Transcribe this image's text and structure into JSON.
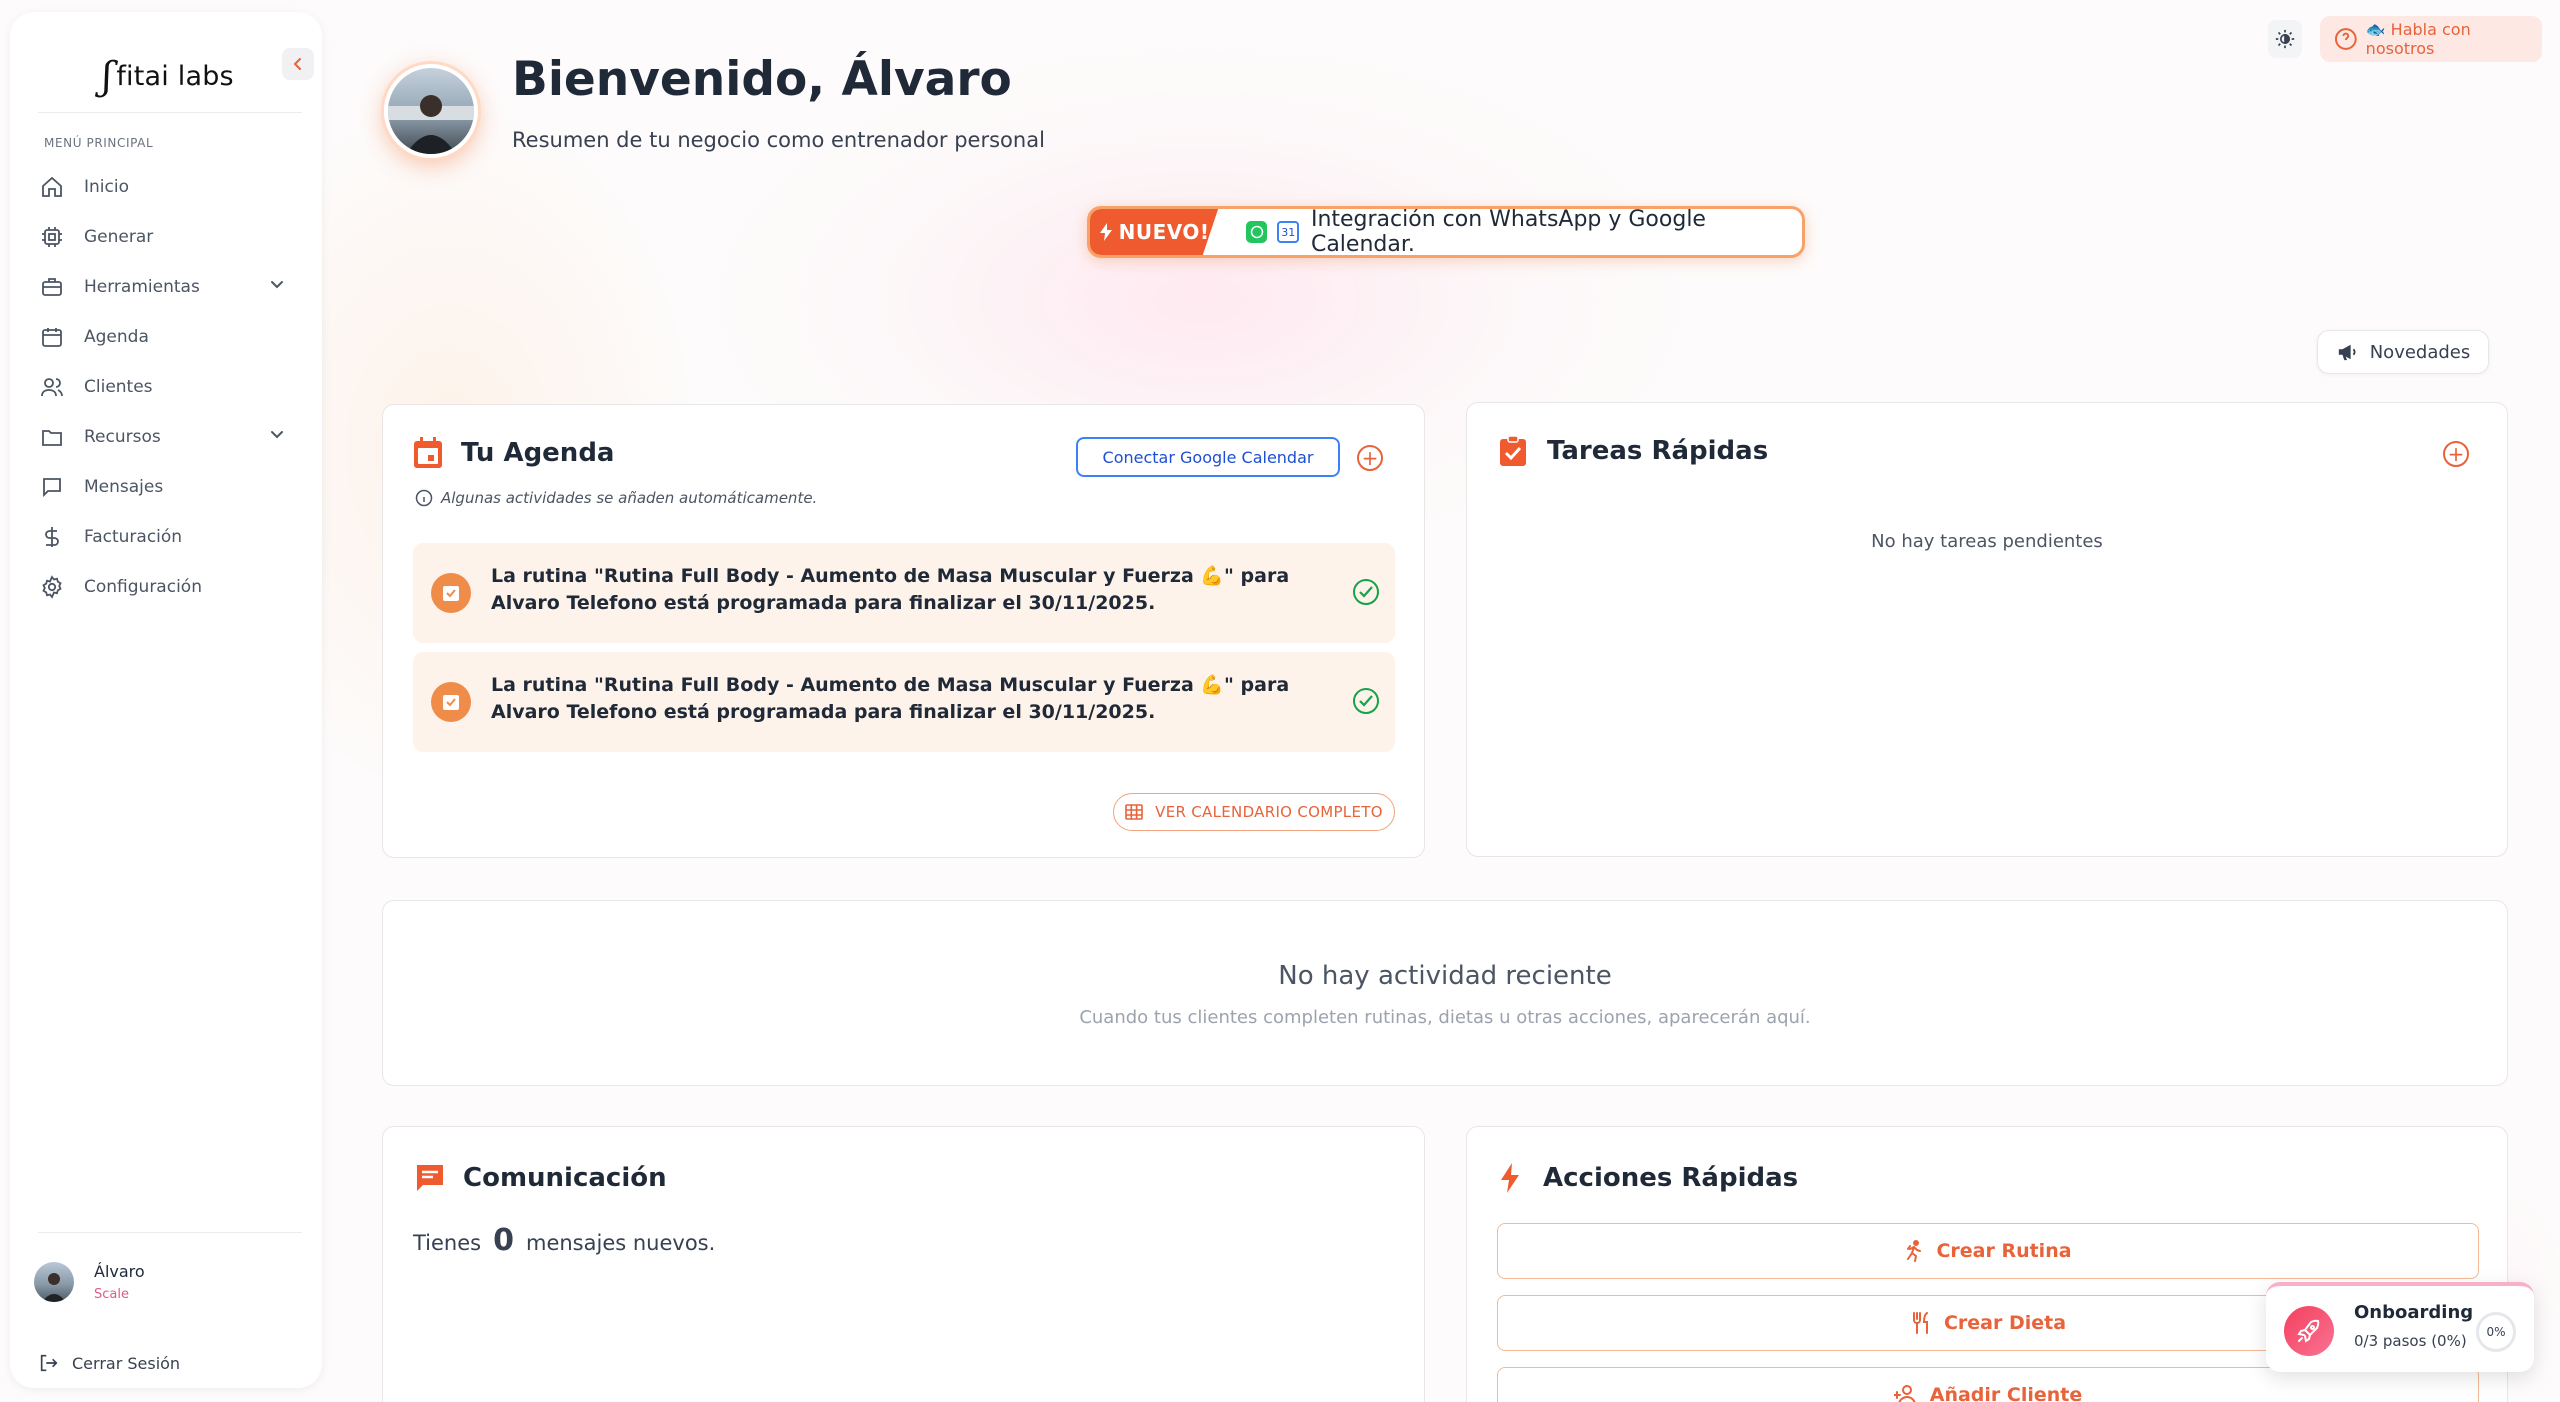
{
  "brand": {
    "logo_mark": "ʃ",
    "logo_text": "fitai labs",
    "accent": "#e8623a"
  },
  "sidebar": {
    "menu_title": "MENÚ PRINCIPAL",
    "items": [
      {
        "label": "Inicio",
        "icon": "home-icon"
      },
      {
        "label": "Generar",
        "icon": "cpu-icon"
      },
      {
        "label": "Herramientas",
        "icon": "briefcase-icon",
        "expandable": true
      },
      {
        "label": "Agenda",
        "icon": "calendar-icon"
      },
      {
        "label": "Clientes",
        "icon": "users-icon"
      },
      {
        "label": "Recursos",
        "icon": "folder-icon",
        "expandable": true
      },
      {
        "label": "Mensajes",
        "icon": "chat-icon"
      },
      {
        "label": "Facturación",
        "icon": "dollar-icon"
      },
      {
        "label": "Configuración",
        "icon": "gear-icon"
      }
    ],
    "user": {
      "name": "Álvaro",
      "plan": "Scale"
    },
    "logout_label": "Cerrar Sesión"
  },
  "topbar": {
    "help_label": "🐟 Habla con nosotros"
  },
  "header": {
    "title": "Bienvenido, Álvaro",
    "subtitle": "Resumen de tu negocio como entrenador personal"
  },
  "banner": {
    "tag": "NUEVO!",
    "text": "Integración con WhatsApp y Google Calendar.",
    "gc_day": "31"
  },
  "novedades_label": "Novedades",
  "agenda": {
    "title": "Tu Agenda",
    "connect_label": "Conectar Google Calendar",
    "note": "Algunas actividades se añaden automáticamente.",
    "events": [
      {
        "text": "La rutina \"Rutina Full Body - Aumento de Masa Muscular y Fuerza 💪\" para Alvaro Telefono está programada para finalizar el 30/11/2025."
      },
      {
        "text": "La rutina \"Rutina Full Body - Aumento de Masa Muscular y Fuerza 💪\" para Alvaro Telefono está programada para finalizar el 30/11/2025."
      }
    ],
    "calendar_link": "VER CALENDARIO COMPLETO"
  },
  "tareas": {
    "title": "Tareas Rápidas",
    "empty": "No hay tareas pendientes"
  },
  "actividad": {
    "title": "No hay actividad reciente",
    "subtitle": "Cuando tus clientes completen rutinas, dietas u otras acciones, aparecerán aquí."
  },
  "comunicacion": {
    "title": "Comunicación",
    "prefix": "Tienes",
    "count": "0",
    "suffix": "mensajes nuevos."
  },
  "acciones": {
    "title": "Acciones Rápidas",
    "buttons": [
      {
        "label": "Crear Rutina",
        "icon": "running-icon"
      },
      {
        "label": "Crear Dieta",
        "icon": "utensils-icon"
      },
      {
        "label": "Añadir Cliente",
        "icon": "user-plus-icon"
      }
    ]
  },
  "onboarding": {
    "title": "Onboarding",
    "progress_text": "0/3 pasos (0%)",
    "percent_label": "0%",
    "progress": 0
  }
}
